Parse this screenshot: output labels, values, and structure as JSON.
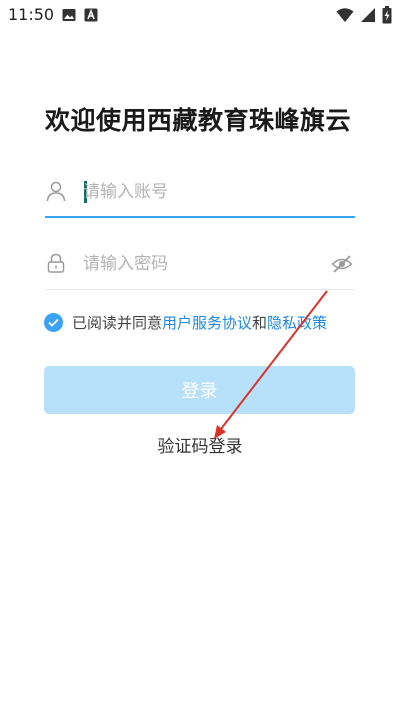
{
  "status_bar": {
    "time": "11:50",
    "left_icons": [
      "image-icon",
      "text-a-icon"
    ],
    "right_icons": [
      "wifi-icon",
      "signal-icon",
      "battery-charging-icon"
    ]
  },
  "title": "欢迎使用西藏教育珠峰旗云",
  "account_field": {
    "placeholder": "请输入账号",
    "value": "",
    "icon": "user-icon",
    "active": true
  },
  "password_field": {
    "placeholder": "请输入密码",
    "value": "",
    "icon": "lock-icon",
    "toggle_icon": "eye-off-icon"
  },
  "agreement": {
    "checked": true,
    "prefix": "已阅读并同意",
    "user_agreement_link": "用户服务协议",
    "conjunction": "和",
    "privacy_link": "隐私政策"
  },
  "login_button": {
    "label": "登录",
    "enabled": false
  },
  "code_login_link": "验证码登录",
  "colors": {
    "accent": "#3aa3f5",
    "link": "#1e88e5",
    "button_disabled": "#b7e1fb",
    "annotation_arrow": "#d9342b"
  }
}
